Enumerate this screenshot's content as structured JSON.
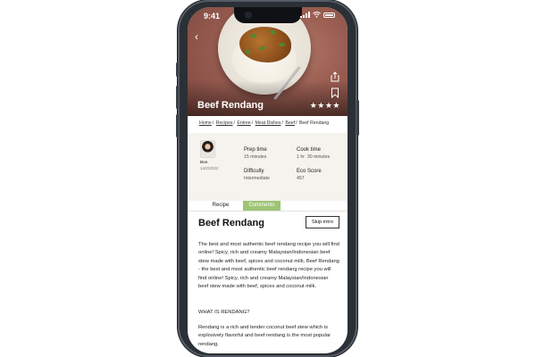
{
  "status": {
    "time": "9:41"
  },
  "hero": {
    "title": "Beef Rendang",
    "stars": "★★★★"
  },
  "breadcrumb": [
    {
      "label": "Home"
    },
    {
      "label": "Recipes"
    },
    {
      "label": "Entree"
    },
    {
      "label": "Meat Dishes"
    },
    {
      "label": "Beef"
    }
  ],
  "breadcrumb_current": "Beef Rendang",
  "author": {
    "name": "Bee",
    "date": "14/2/2022"
  },
  "meta": {
    "prep_label": "Prep time",
    "prep_value": "15 minutes",
    "cook_label": "Cook time",
    "cook_value": "1 hr  30 minutes",
    "difficulty_label": "Difficulty",
    "difficulty_value": "Intermediate",
    "eco_label": "Eco Score",
    "eco_value": "457"
  },
  "tabs": {
    "recipe": "Recipe",
    "comments": "Comments"
  },
  "content": {
    "title": "Beef Rendang",
    "skip_label": "Skip intro",
    "intro": "The best and most authentic beef rendang recipe you will find online! Spicy, rich and creamy Malaysian/Indonesian beef stew made with beef, spices and coconut milk. Beef Rendang - the best and most authentic beef rendang recipe you will find online! Spicy, rich and creamy Malaysian/Indonesian beef stew made with beef, spices and coconut milk.",
    "subhead": "WHAT IS RENDANG?",
    "body": "Rendang is a rich and tender coconut beef stew which is explosively flavorful and beef rendang is the most popular rendang."
  },
  "colors": {
    "accent": "#9dc476",
    "panel": "#f4f3ee",
    "frame": "#2b3036"
  },
  "icons": [
    "back-icon",
    "share-icon",
    "bookmark-icon",
    "star-icon",
    "wifi-icon",
    "battery-icon"
  ]
}
